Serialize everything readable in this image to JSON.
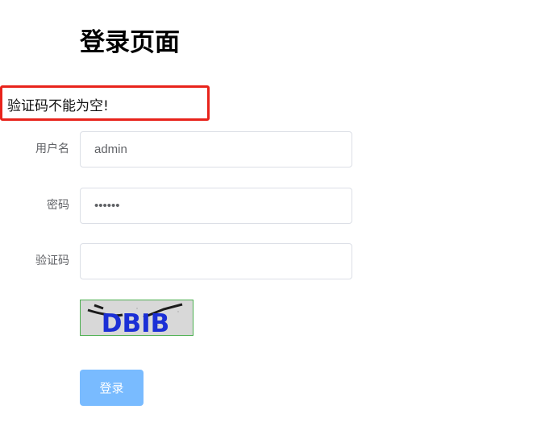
{
  "page": {
    "title": "登录页面",
    "error_message": "验证码不能为空!"
  },
  "form": {
    "username": {
      "label": "用户名",
      "value": "admin"
    },
    "password": {
      "label": "密码",
      "value": "123456"
    },
    "captcha": {
      "label": "验证码",
      "value": "",
      "image_text": "DBIB"
    },
    "login_label": "登录"
  },
  "colors": {
    "error_border": "#e8231b",
    "button_bg": "#79bbff",
    "input_border": "#dcdfe6",
    "label": "#606266",
    "captcha_text": "#1b2fd6"
  }
}
